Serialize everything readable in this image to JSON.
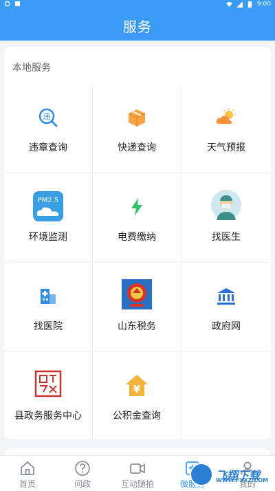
{
  "status_bar": {
    "time": "9:00"
  },
  "header": {
    "title": "服务"
  },
  "section": {
    "title": "本地服务"
  },
  "services": [
    {
      "label": "违章查询",
      "icon": "violation-query-icon"
    },
    {
      "label": "快递查询",
      "icon": "express-query-icon"
    },
    {
      "label": "天气预报",
      "icon": "weather-icon"
    },
    {
      "label": "环境监测",
      "icon": "pm25-monitor-icon"
    },
    {
      "label": "电费缴纳",
      "icon": "electricity-bolt-icon"
    },
    {
      "label": "找医生",
      "icon": "doctor-icon"
    },
    {
      "label": "找医院",
      "icon": "hospital-icon"
    },
    {
      "label": "山东税务",
      "icon": "tax-emblem-icon"
    },
    {
      "label": "政府网",
      "icon": "government-building-icon"
    },
    {
      "label": "县政务服务中心",
      "icon": "seal-icon"
    },
    {
      "label": "公积金查询",
      "icon": "housing-fund-icon"
    }
  ],
  "pm_badge": "PM2.5",
  "violation_glyph": "违",
  "fund_glyph": "¥",
  "tabs": [
    {
      "label": "首页",
      "icon": "home-icon",
      "active": false
    },
    {
      "label": "问政",
      "icon": "question-icon",
      "active": false
    },
    {
      "label": "互动随拍",
      "icon": "camera-icon",
      "active": false
    },
    {
      "label": "微服务",
      "icon": "star-icon",
      "active": true
    },
    {
      "label": "我的",
      "icon": "user-icon",
      "active": false
    }
  ],
  "watermark": {
    "text": "飞翔下载",
    "sub": "WWW.FXXZ.COM"
  },
  "colors": {
    "primary": "#3b9cf5",
    "background": "#f2f4f7"
  }
}
